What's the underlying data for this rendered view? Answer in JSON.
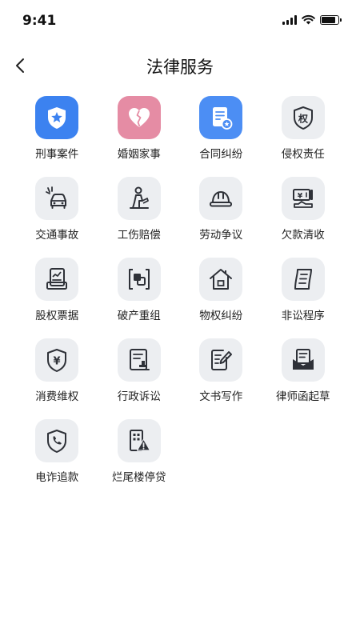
{
  "status": {
    "time": "9:41"
  },
  "nav": {
    "title": "法律服务"
  },
  "services": [
    {
      "label": "刑事案件"
    },
    {
      "label": "婚姻家事"
    },
    {
      "label": "合同纠纷"
    },
    {
      "label": "侵权责任",
      "glyph": "权"
    },
    {
      "label": "交通事故"
    },
    {
      "label": "工伤赔偿"
    },
    {
      "label": "劳动争议"
    },
    {
      "label": "欠款清收",
      "glyph": "¥"
    },
    {
      "label": "股权票据"
    },
    {
      "label": "破产重组"
    },
    {
      "label": "物权纠纷"
    },
    {
      "label": "非讼程序"
    },
    {
      "label": "消费维权",
      "glyph": "¥"
    },
    {
      "label": "行政诉讼"
    },
    {
      "label": "文书写作"
    },
    {
      "label": "律师函起草"
    },
    {
      "label": "电诈追款"
    },
    {
      "label": "烂尾楼停贷"
    }
  ],
  "colors": {
    "accent_blue": "#3C82F0",
    "accent_pink": "#E58CA4",
    "icon_bg": "#ECEEF1",
    "icon_stroke": "#2E3138"
  }
}
